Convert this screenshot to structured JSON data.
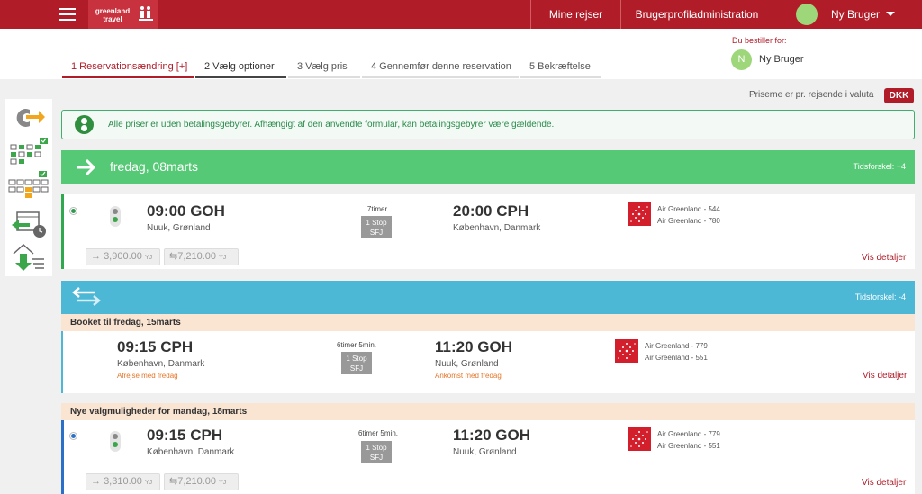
{
  "topbar": {
    "logo_text": "greenland travel",
    "nav": [
      "Mine rejser",
      "Brugerprofiladministration"
    ],
    "user": "Ny Bruger"
  },
  "steps": [
    {
      "label": "1 Reservationsændring [+]",
      "state": "active"
    },
    {
      "label": "2 Vælg optioner",
      "state": "current"
    },
    {
      "label": "3 Vælg pris",
      "state": "pending"
    },
    {
      "label": "4 Gennemfør denne reservation",
      "state": "pending"
    },
    {
      "label": "5 Bekræftelse",
      "state": "pending"
    }
  ],
  "booker": {
    "label": "Du bestiller for:",
    "initial": "N",
    "name": "Ny Bruger"
  },
  "currency": {
    "note": "Priserne er pr. rejsende i valuta",
    "code": "DKK"
  },
  "info": {
    "text": "Alle priser er uden betalingsgebyrer. Afhængigt af den anvendte formular, kan betalingsgebyrer være gældende."
  },
  "outbound": {
    "date": "fredag, 08marts",
    "time_diff": "Tidsforskel: +4",
    "flight": {
      "dep_time": "09:00 GOH",
      "dep_city": "Nuuk, Grønland",
      "duration": "7timer",
      "stops": "1 Stop",
      "via": "SFJ",
      "arr_time": "20:00 CPH",
      "arr_city": "København, Danmark",
      "airlines": [
        "Air Greenland - 544",
        "Air Greenland - 780"
      ],
      "details": "Vis detaljer",
      "price_oneway": "3,900.00",
      "price_return": "7,210.00",
      "fare_class": "YJ"
    }
  },
  "return": {
    "time_diff": "Tidsforskel: -4",
    "booked_label": "Booket til fredag, 15marts",
    "booked": {
      "dep_time": "09:15 CPH",
      "dep_city": "København, Danmark",
      "dep_note": "Afrejse med fredag",
      "duration": "6timer 5min.",
      "stops": "1 Stop",
      "via": "SFJ",
      "arr_time": "11:20 GOH",
      "arr_city": "Nuuk, Grønland",
      "arr_note": "Ankomst med fredag",
      "airlines": [
        "Air Greenland - 779",
        "Air Greenland - 551"
      ],
      "details": "Vis detaljer"
    },
    "new_label": "Nye valgmuligheder for mandag, 18marts",
    "new": {
      "dep_time": "09:15 CPH",
      "dep_city": "København, Danmark",
      "duration": "6timer 5min.",
      "stops": "1 Stop",
      "via": "SFJ",
      "arr_time": "11:20 GOH",
      "arr_city": "Nuuk, Grønland",
      "airlines": [
        "Air Greenland - 779",
        "Air Greenland - 551"
      ],
      "details": "Vis detaljer",
      "price_oneway": "3,310.00",
      "price_return": "7,210.00",
      "fare_class": "YJ"
    }
  },
  "colors": {
    "brand": "#b01c28",
    "green": "#56c976",
    "blue": "#4cb8d6",
    "peach": "#fae4d2"
  }
}
